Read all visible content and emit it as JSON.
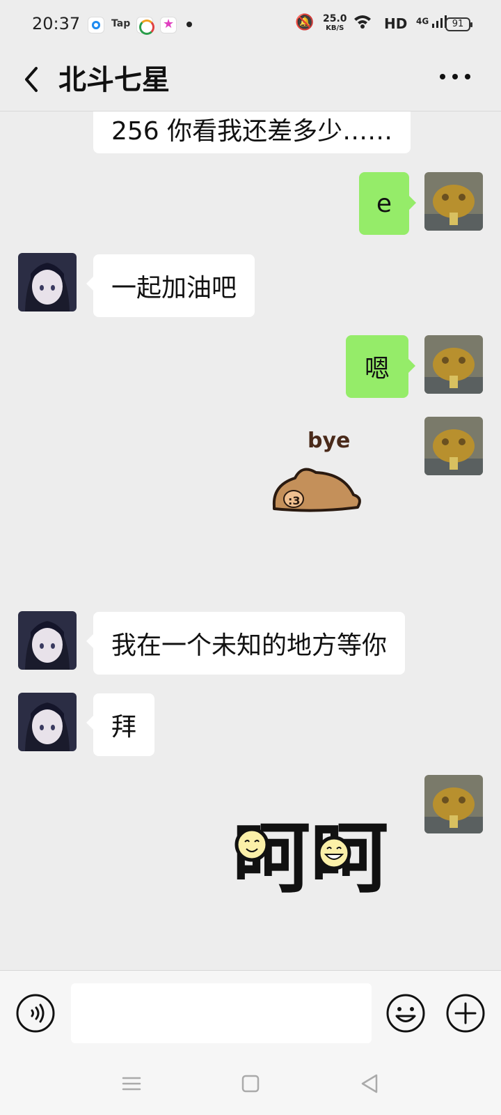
{
  "status_bar": {
    "time": "20:37",
    "app_label": "Tap",
    "net_speed": "25.0",
    "net_unit": "KB/S",
    "hd": "HD",
    "network": "4G",
    "battery": "91"
  },
  "header": {
    "title": "北斗七星"
  },
  "messages": [
    {
      "sender": "other",
      "text": "256 你看我还差多少……"
    },
    {
      "sender": "me",
      "text": "e"
    },
    {
      "sender": "other",
      "text": "一起加油吧"
    },
    {
      "sender": "me",
      "text": "嗯"
    },
    {
      "sender": "me",
      "sticker": "bye",
      "sticker_text": "bye"
    },
    {
      "sender": "other",
      "text": "我在一个未知的地方等你"
    },
    {
      "sender": "other",
      "text": "拜"
    },
    {
      "sender": "me",
      "sticker": "hehe",
      "sticker_text": "呵呵"
    }
  ],
  "input": {
    "value": "",
    "placeholder": ""
  },
  "icons": {
    "back": "chevron-left-icon",
    "more": "more-dots-icon",
    "voice": "voice-icon",
    "emoji": "emoji-icon",
    "plus": "plus-icon"
  },
  "colors": {
    "background": "#ededed",
    "incoming_bubble": "#ffffff",
    "outgoing_bubble": "#95ec69",
    "bar": "#f6f6f6"
  }
}
